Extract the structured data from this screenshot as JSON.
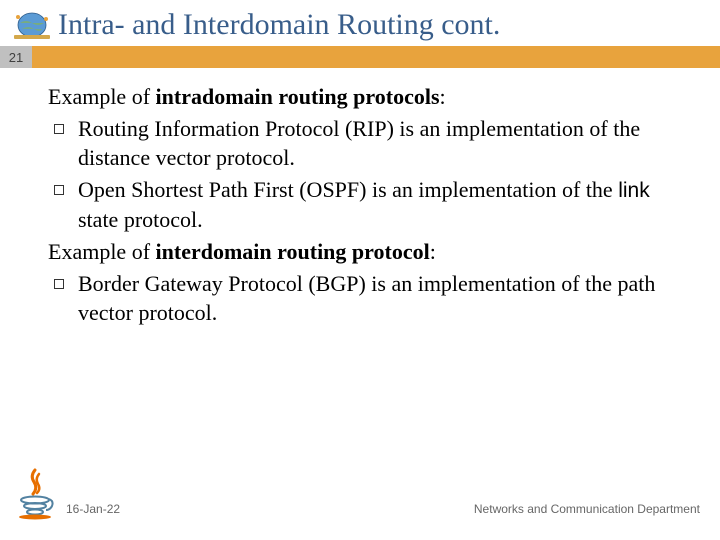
{
  "header": {
    "title": "Intra- and Interdomain Routing cont.",
    "page_number": "21"
  },
  "content": {
    "heading1_prefix": "Example of ",
    "heading1_bold": "intradomain routing protocols",
    "heading1_suffix": ":",
    "bullet1": "Routing Information Protocol (RIP) is an implementation of the distance vector protocol.",
    "bullet2_a": "Open Shortest Path First (OSPF) is an implementation of the ",
    "bullet2_link": "link",
    "bullet2_b": " state protocol.",
    "heading2_prefix": "Example of ",
    "heading2_bold": "interdomain routing protocol",
    "heading2_suffix": ":",
    "bullet3": "Border Gateway Protocol (BGP) is an implementation of the path vector protocol."
  },
  "footer": {
    "date": "16-Jan-22",
    "department": "Networks and Communication Department"
  }
}
